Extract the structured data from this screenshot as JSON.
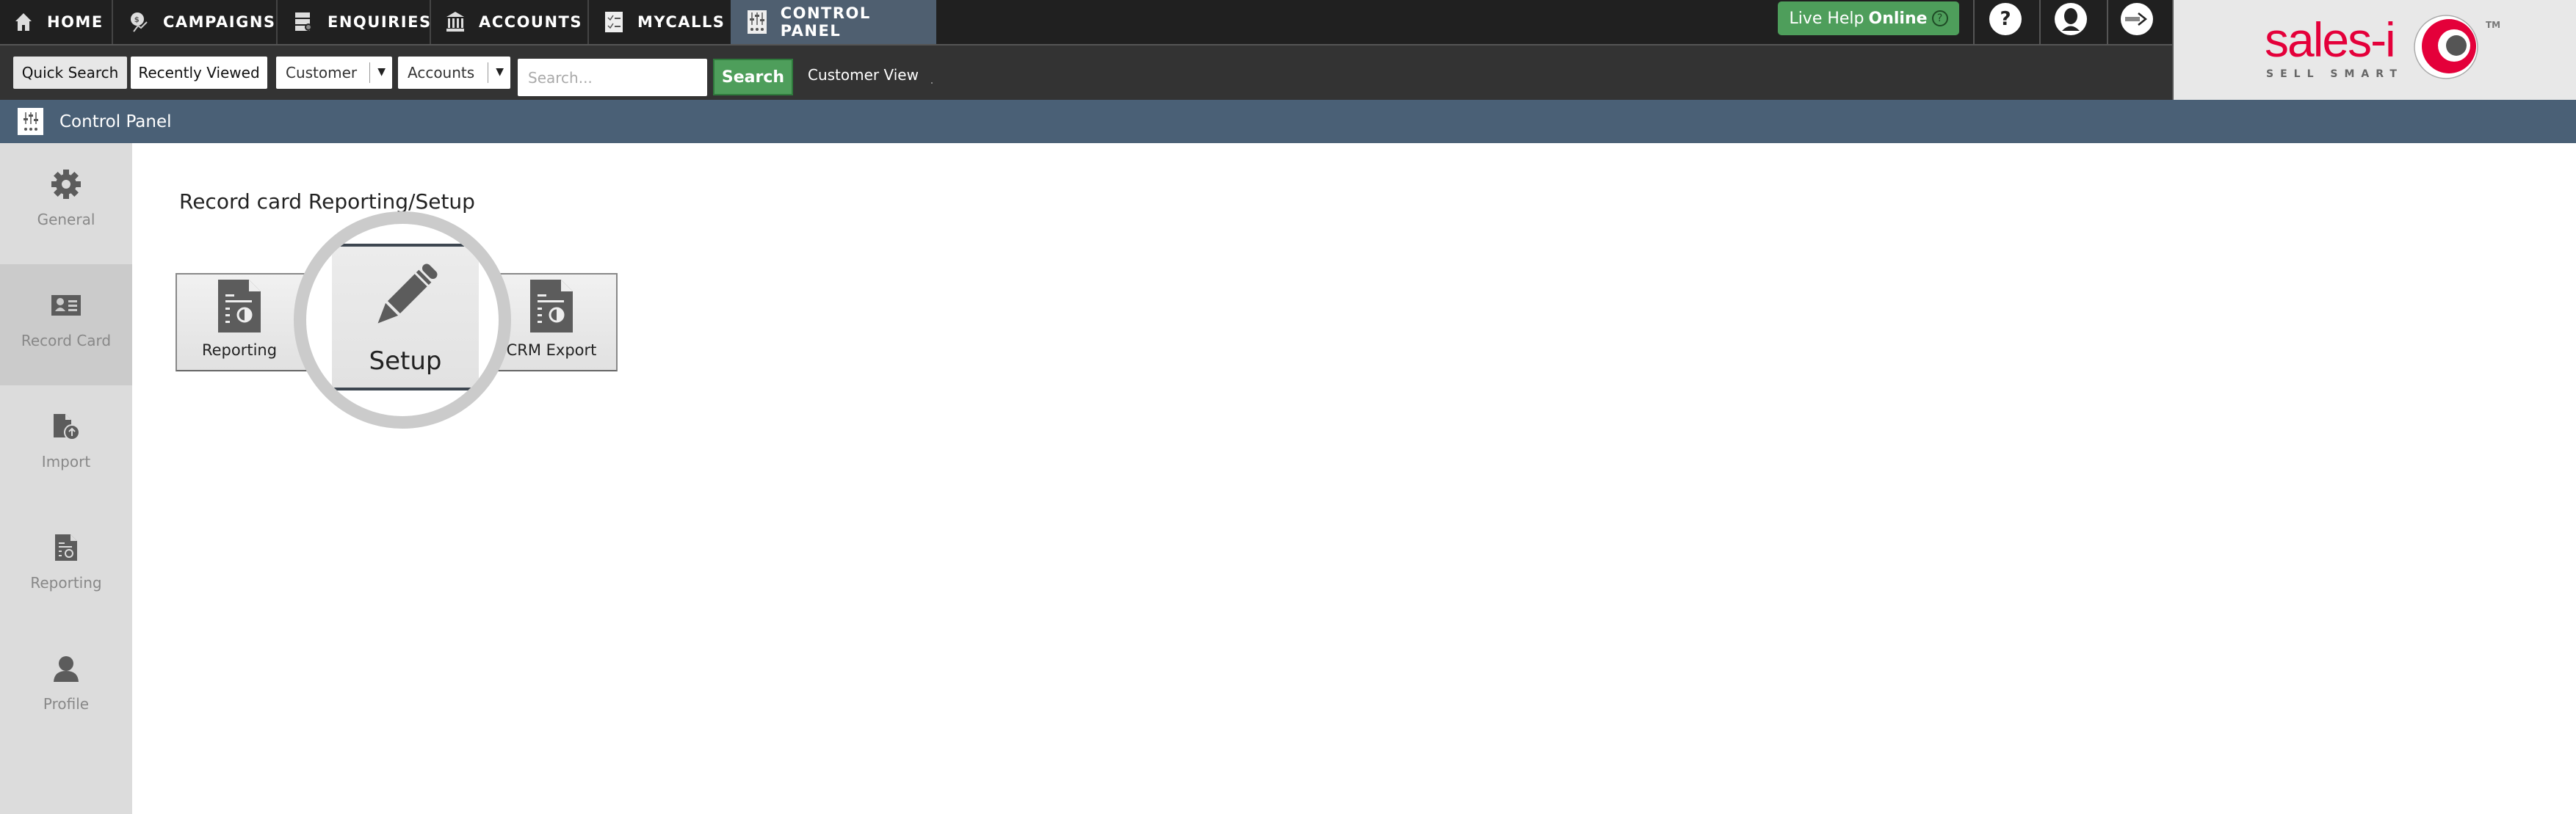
{
  "nav": {
    "tabs": [
      {
        "label": "HOME",
        "icon": "home-icon"
      },
      {
        "label": "CAMPAIGNS",
        "icon": "campaigns-icon"
      },
      {
        "label": "ENQUIRIES",
        "icon": "enquiries-icon"
      },
      {
        "label": "ACCOUNTS",
        "icon": "accounts-icon"
      },
      {
        "label": "MYCALLS",
        "icon": "mycalls-icon"
      },
      {
        "label": "CONTROL PANEL",
        "icon": "control-panel-icon",
        "active": true
      }
    ],
    "live_help": {
      "prefix": "Live Help",
      "status": "Online",
      "icon": "question-icon"
    },
    "icons": [
      "help-icon",
      "user-icon",
      "logout-icon"
    ],
    "help_glyph": "?"
  },
  "toolbar": {
    "quick_search": "Quick Search",
    "recently_viewed": "Recently Viewed",
    "type_select": "Customer",
    "scope_select": "Accounts",
    "search_placeholder": "Search...",
    "search_value": "",
    "search_button": "Search",
    "customer_view": "Customer View"
  },
  "logo": {
    "name": "sales-i",
    "tagline": "SELL SMART",
    "tm": "TM",
    "colors": {
      "red": "#e4003a",
      "gray": "#666666"
    }
  },
  "header": {
    "title": "Control Panel"
  },
  "sidebar": {
    "items": [
      {
        "label": "General",
        "icon": "gear-icon"
      },
      {
        "label": "Record Card",
        "icon": "record-card-icon",
        "active": true
      },
      {
        "label": "Import",
        "icon": "import-icon"
      },
      {
        "label": "Reporting",
        "icon": "report-icon"
      },
      {
        "label": "Profile",
        "icon": "profile-icon"
      }
    ]
  },
  "main": {
    "title": "Record card Reporting/Setup",
    "buttons": [
      {
        "label": "Reporting",
        "icon": "report-icon"
      },
      {
        "label": "Setup",
        "icon": "pencil-icon",
        "highlighted": true
      },
      {
        "label": "CRM Export",
        "icon": "report-icon"
      }
    ]
  },
  "colors": {
    "topbar": "#202020",
    "toolbar": "#333333",
    "accent_blue": "#4a6076",
    "active_tab": "#4f5f70",
    "green": "#4e9e5b",
    "sidebar": "#dcdcdc",
    "sidebar_active": "#cbcbcb"
  }
}
